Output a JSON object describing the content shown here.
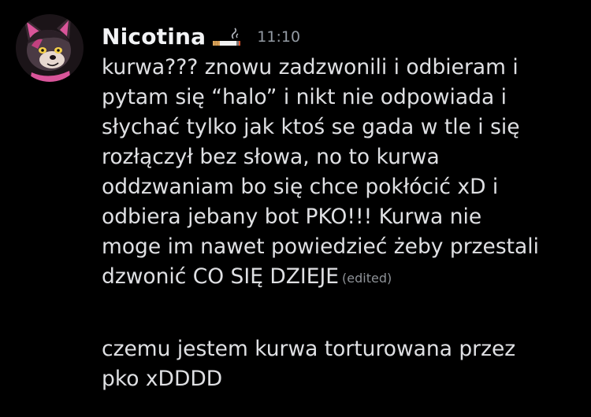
{
  "message": {
    "author": {
      "username": "Nicotina",
      "role_icon": "cigarette-icon",
      "avatar": "wolf-avatar"
    },
    "timestamp": "11:10",
    "first_body": "kurwa??? znowu zadzwonili i odbieram i\npytam się “halo” i nikt nie odpowiada i\nsłychać tylko jak ktoś se gada w tle i się\nrozłączył bez słowa, no to kurwa\noddzwaniam bo się chce pokłócić xD i\nodbiera jebany bot PKO!!! Kurwa nie\nmoge im nawet powiedzieć żeby przestali\ndzwonić CO SIĘ DZIEJE",
    "edited_label": "(edited)",
    "second_body": "czemu jestem kurwa torturowana przez\npko xDDDD"
  },
  "colors": {
    "background": "#000000",
    "username": "#f2f3f5",
    "text": "#dfe0e3",
    "muted": "#949ba4"
  }
}
